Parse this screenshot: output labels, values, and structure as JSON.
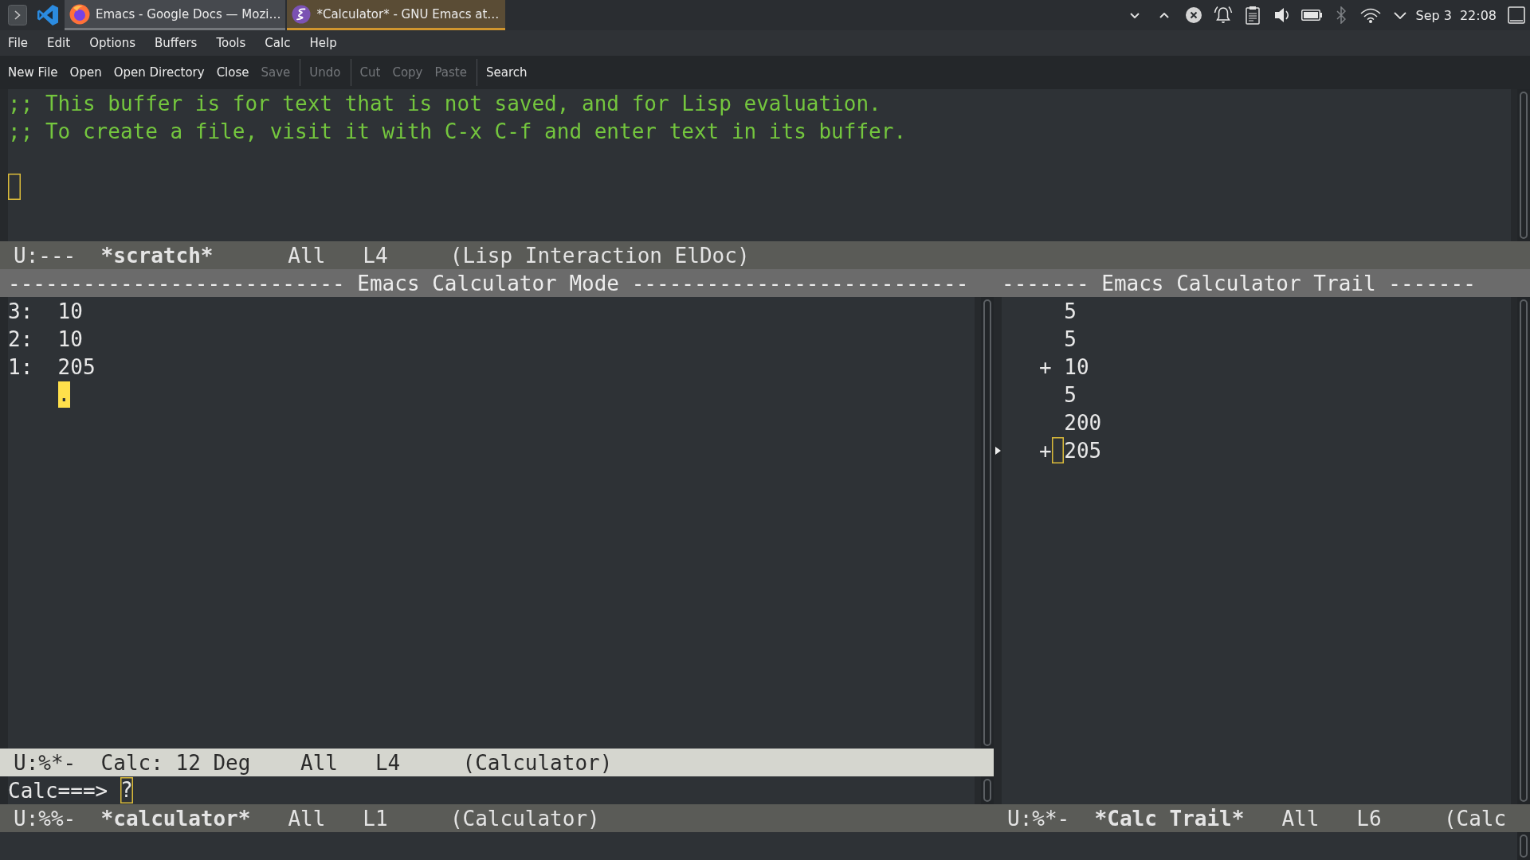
{
  "taskbar": {
    "tasks": [
      {
        "kind": "browser",
        "title": "Emacs - Google Docs — Mozi…",
        "selected": false
      },
      {
        "kind": "editor",
        "title": "*Calculator* - GNU Emacs at…",
        "selected": true
      }
    ],
    "bluetooth": {
      "on": false
    },
    "clock": {
      "date": "Sep 3",
      "time": "22:08"
    }
  },
  "menu_bar": {
    "items": [
      "File",
      "Edit",
      "Options",
      "Buffers",
      "Tools",
      "Calc",
      "Help"
    ]
  },
  "tool_bar": {
    "groups": [
      [
        {
          "label": "New File",
          "disabled": false
        },
        {
          "label": "Open",
          "disabled": false
        },
        {
          "label": "Open Directory",
          "disabled": false
        },
        {
          "label": "Close",
          "disabled": false
        },
        {
          "label": "Save",
          "disabled": true
        }
      ],
      [
        {
          "label": "Undo",
          "disabled": true
        }
      ],
      [
        {
          "label": "Cut",
          "disabled": true
        },
        {
          "label": "Copy",
          "disabled": true
        },
        {
          "label": "Paste",
          "disabled": true
        }
      ],
      [
        {
          "label": "Search",
          "disabled": false
        }
      ]
    ]
  },
  "scratch_window": {
    "lines": [
      {
        "kind": "comment",
        "text": ";; This buffer is for text that is not saved, and for Lisp evaluation."
      },
      {
        "kind": "comment",
        "text": ";; To create a file, visit it with C-x C-f and enter text in its buffer."
      },
      {
        "kind": "blank"
      },
      {
        "kind": "cursor",
        "filled": false
      }
    ],
    "mode_line": {
      "kind": "buffer",
      "active": false,
      "status": "U:---",
      "buffer": "*scratch*",
      "position": "All",
      "line": "L4",
      "modes": "(Lisp Interaction ElDoc)"
    }
  },
  "calc_window": {
    "header": "--------------------------- Emacs Calculator Mode ---------------------------",
    "stack": [
      {
        "number": "3:",
        "value": "10"
      },
      {
        "number": "2:",
        "value": "10"
      },
      {
        "number": "1:",
        "value": "205"
      }
    ],
    "marker": {
      "text": ".",
      "filled": true
    },
    "mode_line": {
      "kind": "calc",
      "active": true,
      "status": "U:%*-",
      "buffer": "Calc: 12 Deg",
      "position": "All",
      "line": "L4",
      "modes": "(Calculator)"
    }
  },
  "prompt_window": {
    "prompt": "Calc===>",
    "input": "?",
    "cursor_filled": false,
    "mode_line": {
      "kind": "buffer",
      "active": false,
      "status": "U:%%-",
      "buffer": "*calculator*",
      "position": "All",
      "line": "L1",
      "modes": "(Calculator)"
    }
  },
  "trail_window": {
    "header": "------- Emacs Calculator Trail -------",
    "entries": [
      {
        "value": "5",
        "current": false
      },
      {
        "value": "5",
        "current": false
      },
      {
        "op": "+",
        "value": "10",
        "current": false
      },
      {
        "value": "5",
        "current": false
      },
      {
        "value": "200",
        "current": false
      },
      {
        "op": "+",
        "value": "205",
        "current": true
      }
    ],
    "mode_line": {
      "kind": "buffer",
      "active": false,
      "status": "U:%*-",
      "buffer": "*Calc Trail*",
      "position": "All",
      "line": "L6",
      "modes": "(Calc"
    }
  }
}
